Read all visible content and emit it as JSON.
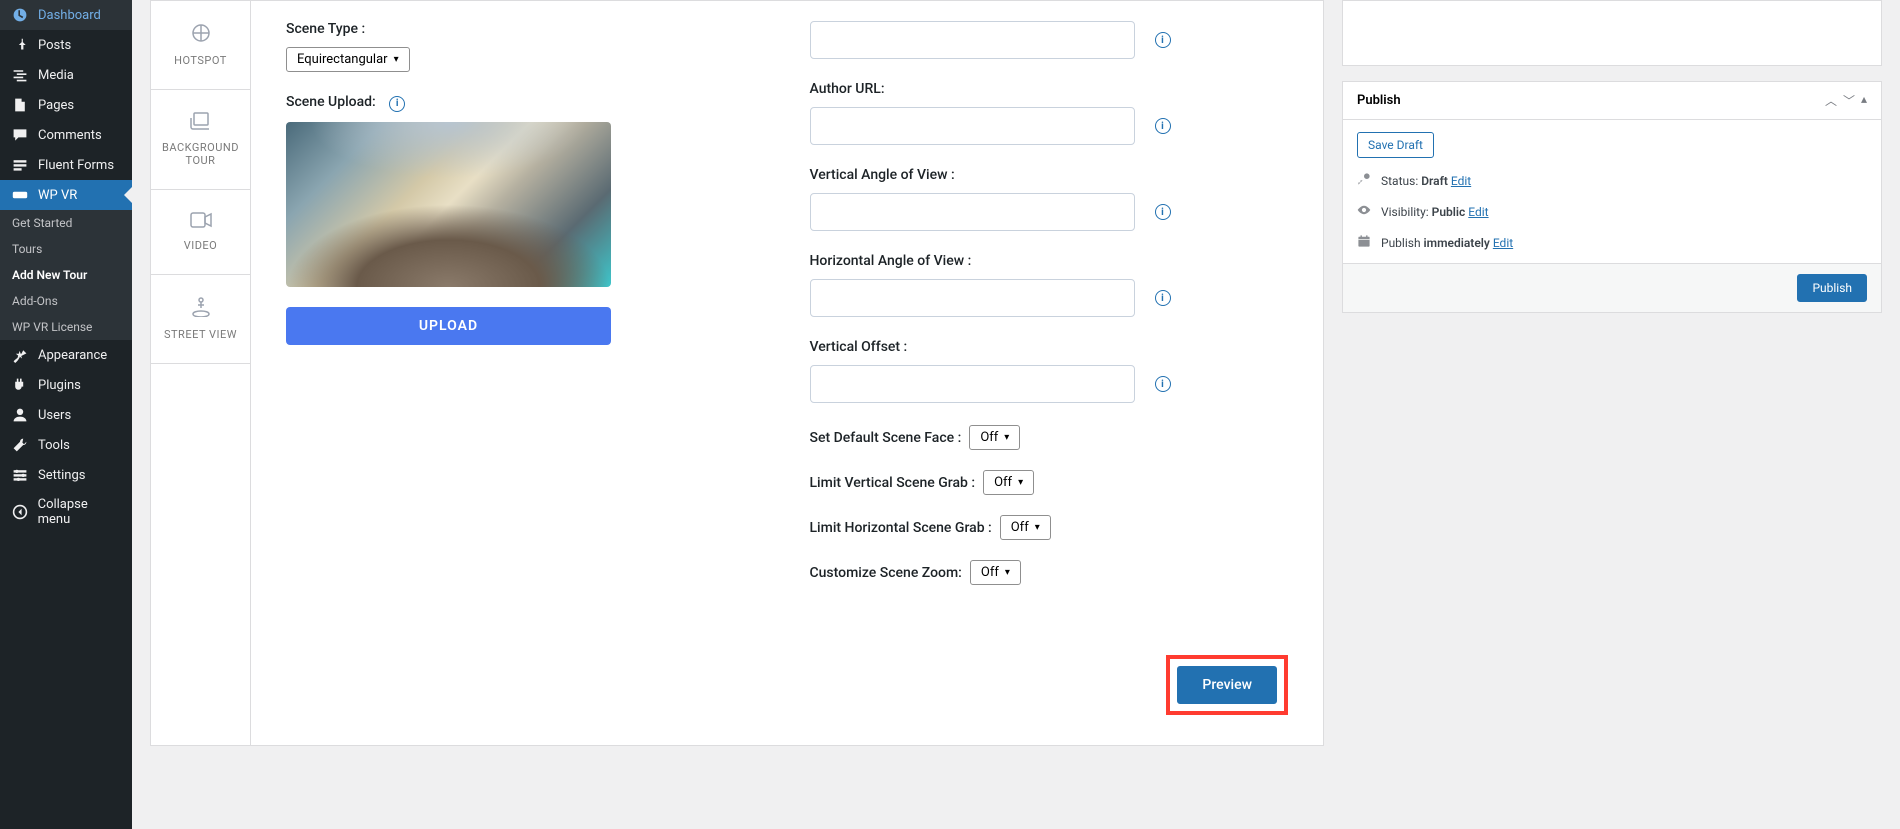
{
  "sidebar": {
    "items": [
      {
        "label": "Dashboard",
        "icon": "dashboard"
      },
      {
        "label": "Posts",
        "icon": "pin"
      },
      {
        "label": "Media",
        "icon": "media"
      },
      {
        "label": "Pages",
        "icon": "pages"
      },
      {
        "label": "Comments",
        "icon": "comments"
      },
      {
        "label": "Fluent Forms",
        "icon": "forms"
      },
      {
        "label": "WP VR",
        "icon": "vr"
      },
      {
        "label": "Appearance",
        "icon": "appearance"
      },
      {
        "label": "Plugins",
        "icon": "plugins"
      },
      {
        "label": "Users",
        "icon": "users"
      },
      {
        "label": "Tools",
        "icon": "tools"
      },
      {
        "label": "Settings",
        "icon": "settings"
      },
      {
        "label": "Collapse menu",
        "icon": "collapse"
      }
    ],
    "submenu": [
      {
        "label": "Get Started"
      },
      {
        "label": "Tours"
      },
      {
        "label": "Add New Tour"
      },
      {
        "label": "Add-Ons"
      },
      {
        "label": "WP VR License"
      }
    ]
  },
  "side_tabs": [
    {
      "label": "HOTSPOT",
      "icon": "⊕"
    },
    {
      "label": "BACKGROUND TOUR",
      "icon": "▭"
    },
    {
      "label": "VIDEO",
      "icon": "⏵"
    },
    {
      "label": "STREET VIEW",
      "icon": "📍"
    }
  ],
  "left_form": {
    "scene_type_label": "Scene Type :",
    "scene_type_value": "Equirectangular",
    "scene_upload_label": "Scene Upload:",
    "upload_button": "UPLOAD"
  },
  "right_form": {
    "author_url_label": "Author URL:",
    "vaov_label": "Vertical Angle of View :",
    "haov_label": "Horizontal Angle of View :",
    "voffset_label": "Vertical Offset :",
    "default_face_label": "Set Default Scene Face :",
    "default_face_value": "Off",
    "lvgrab_label": "Limit Vertical Scene Grab :",
    "lvgrab_value": "Off",
    "lhgrab_label": "Limit Horizontal Scene Grab :",
    "lhgrab_value": "Off",
    "zoom_label": "Customize Scene Zoom:",
    "zoom_value": "Off"
  },
  "preview_button": "Preview",
  "publish": {
    "title": "Publish",
    "save_draft": "Save Draft",
    "status_label": "Status: ",
    "status_value": "Draft",
    "visibility_label": "Visibility: ",
    "visibility_value": "Public",
    "publish_label": "Publish ",
    "publish_value": "immediately",
    "edit": "Edit",
    "publish_button": "Publish"
  }
}
